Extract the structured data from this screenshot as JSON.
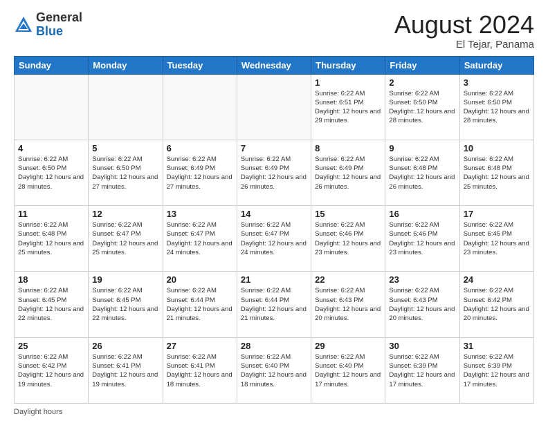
{
  "header": {
    "logo_general": "General",
    "logo_blue": "Blue",
    "main_title": "August 2024",
    "subtitle": "El Tejar, Panama"
  },
  "footer": {
    "daylight_label": "Daylight hours"
  },
  "calendar": {
    "days_of_week": [
      "Sunday",
      "Monday",
      "Tuesday",
      "Wednesday",
      "Thursday",
      "Friday",
      "Saturday"
    ],
    "weeks": [
      [
        {
          "day": "",
          "empty": true
        },
        {
          "day": "",
          "empty": true
        },
        {
          "day": "",
          "empty": true
        },
        {
          "day": "",
          "empty": true
        },
        {
          "day": "1",
          "sunrise": "Sunrise: 6:22 AM",
          "sunset": "Sunset: 6:51 PM",
          "daylight": "Daylight: 12 hours and 29 minutes."
        },
        {
          "day": "2",
          "sunrise": "Sunrise: 6:22 AM",
          "sunset": "Sunset: 6:50 PM",
          "daylight": "Daylight: 12 hours and 28 minutes."
        },
        {
          "day": "3",
          "sunrise": "Sunrise: 6:22 AM",
          "sunset": "Sunset: 6:50 PM",
          "daylight": "Daylight: 12 hours and 28 minutes."
        }
      ],
      [
        {
          "day": "4",
          "sunrise": "Sunrise: 6:22 AM",
          "sunset": "Sunset: 6:50 PM",
          "daylight": "Daylight: 12 hours and 28 minutes."
        },
        {
          "day": "5",
          "sunrise": "Sunrise: 6:22 AM",
          "sunset": "Sunset: 6:50 PM",
          "daylight": "Daylight: 12 hours and 27 minutes."
        },
        {
          "day": "6",
          "sunrise": "Sunrise: 6:22 AM",
          "sunset": "Sunset: 6:49 PM",
          "daylight": "Daylight: 12 hours and 27 minutes."
        },
        {
          "day": "7",
          "sunrise": "Sunrise: 6:22 AM",
          "sunset": "Sunset: 6:49 PM",
          "daylight": "Daylight: 12 hours and 26 minutes."
        },
        {
          "day": "8",
          "sunrise": "Sunrise: 6:22 AM",
          "sunset": "Sunset: 6:49 PM",
          "daylight": "Daylight: 12 hours and 26 minutes."
        },
        {
          "day": "9",
          "sunrise": "Sunrise: 6:22 AM",
          "sunset": "Sunset: 6:48 PM",
          "daylight": "Daylight: 12 hours and 26 minutes."
        },
        {
          "day": "10",
          "sunrise": "Sunrise: 6:22 AM",
          "sunset": "Sunset: 6:48 PM",
          "daylight": "Daylight: 12 hours and 25 minutes."
        }
      ],
      [
        {
          "day": "11",
          "sunrise": "Sunrise: 6:22 AM",
          "sunset": "Sunset: 6:48 PM",
          "daylight": "Daylight: 12 hours and 25 minutes."
        },
        {
          "day": "12",
          "sunrise": "Sunrise: 6:22 AM",
          "sunset": "Sunset: 6:47 PM",
          "daylight": "Daylight: 12 hours and 25 minutes."
        },
        {
          "day": "13",
          "sunrise": "Sunrise: 6:22 AM",
          "sunset": "Sunset: 6:47 PM",
          "daylight": "Daylight: 12 hours and 24 minutes."
        },
        {
          "day": "14",
          "sunrise": "Sunrise: 6:22 AM",
          "sunset": "Sunset: 6:47 PM",
          "daylight": "Daylight: 12 hours and 24 minutes."
        },
        {
          "day": "15",
          "sunrise": "Sunrise: 6:22 AM",
          "sunset": "Sunset: 6:46 PM",
          "daylight": "Daylight: 12 hours and 23 minutes."
        },
        {
          "day": "16",
          "sunrise": "Sunrise: 6:22 AM",
          "sunset": "Sunset: 6:46 PM",
          "daylight": "Daylight: 12 hours and 23 minutes."
        },
        {
          "day": "17",
          "sunrise": "Sunrise: 6:22 AM",
          "sunset": "Sunset: 6:45 PM",
          "daylight": "Daylight: 12 hours and 23 minutes."
        }
      ],
      [
        {
          "day": "18",
          "sunrise": "Sunrise: 6:22 AM",
          "sunset": "Sunset: 6:45 PM",
          "daylight": "Daylight: 12 hours and 22 minutes."
        },
        {
          "day": "19",
          "sunrise": "Sunrise: 6:22 AM",
          "sunset": "Sunset: 6:45 PM",
          "daylight": "Daylight: 12 hours and 22 minutes."
        },
        {
          "day": "20",
          "sunrise": "Sunrise: 6:22 AM",
          "sunset": "Sunset: 6:44 PM",
          "daylight": "Daylight: 12 hours and 21 minutes."
        },
        {
          "day": "21",
          "sunrise": "Sunrise: 6:22 AM",
          "sunset": "Sunset: 6:44 PM",
          "daylight": "Daylight: 12 hours and 21 minutes."
        },
        {
          "day": "22",
          "sunrise": "Sunrise: 6:22 AM",
          "sunset": "Sunset: 6:43 PM",
          "daylight": "Daylight: 12 hours and 20 minutes."
        },
        {
          "day": "23",
          "sunrise": "Sunrise: 6:22 AM",
          "sunset": "Sunset: 6:43 PM",
          "daylight": "Daylight: 12 hours and 20 minutes."
        },
        {
          "day": "24",
          "sunrise": "Sunrise: 6:22 AM",
          "sunset": "Sunset: 6:42 PM",
          "daylight": "Daylight: 12 hours and 20 minutes."
        }
      ],
      [
        {
          "day": "25",
          "sunrise": "Sunrise: 6:22 AM",
          "sunset": "Sunset: 6:42 PM",
          "daylight": "Daylight: 12 hours and 19 minutes."
        },
        {
          "day": "26",
          "sunrise": "Sunrise: 6:22 AM",
          "sunset": "Sunset: 6:41 PM",
          "daylight": "Daylight: 12 hours and 19 minutes."
        },
        {
          "day": "27",
          "sunrise": "Sunrise: 6:22 AM",
          "sunset": "Sunset: 6:41 PM",
          "daylight": "Daylight: 12 hours and 18 minutes."
        },
        {
          "day": "28",
          "sunrise": "Sunrise: 6:22 AM",
          "sunset": "Sunset: 6:40 PM",
          "daylight": "Daylight: 12 hours and 18 minutes."
        },
        {
          "day": "29",
          "sunrise": "Sunrise: 6:22 AM",
          "sunset": "Sunset: 6:40 PM",
          "daylight": "Daylight: 12 hours and 17 minutes."
        },
        {
          "day": "30",
          "sunrise": "Sunrise: 6:22 AM",
          "sunset": "Sunset: 6:39 PM",
          "daylight": "Daylight: 12 hours and 17 minutes."
        },
        {
          "day": "31",
          "sunrise": "Sunrise: 6:22 AM",
          "sunset": "Sunset: 6:39 PM",
          "daylight": "Daylight: 12 hours and 17 minutes."
        }
      ]
    ]
  }
}
